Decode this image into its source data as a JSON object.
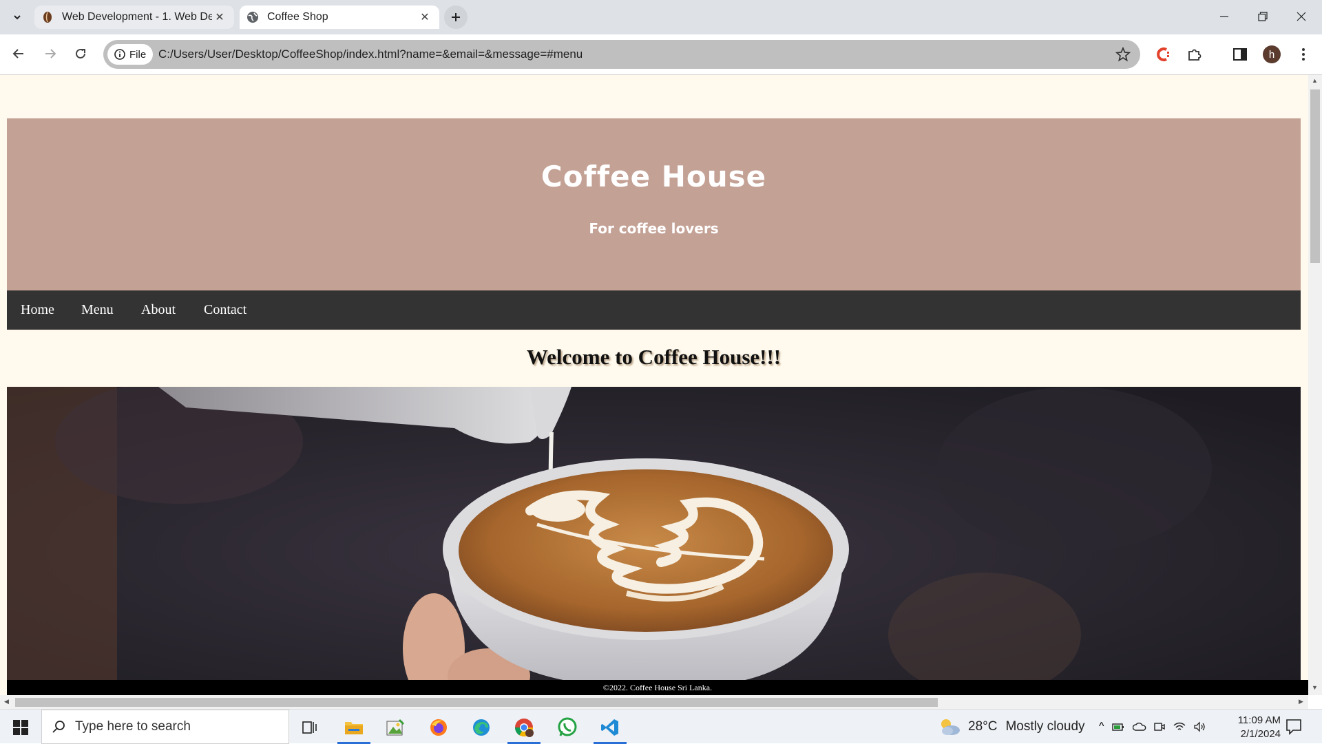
{
  "browser": {
    "tabs": [
      {
        "title": "Web Development - 1. Web De",
        "state": "inactive"
      },
      {
        "title": "Coffee Shop",
        "state": "active"
      }
    ],
    "address": {
      "chip_label": "File",
      "url": "C:/Users/User/Desktop/CoffeeShop/index.html?name=&email=&message=#menu"
    },
    "profile_initial": "h"
  },
  "page": {
    "site_title": "Coffee House",
    "tagline": "For coffee lovers",
    "nav": [
      "Home",
      "Menu",
      "About",
      "Contact"
    ],
    "welcome": "Welcome to Coffee House!!!",
    "footer": "©2022. Coffee House Sri Lanka.",
    "colors": {
      "background": "#fffaed",
      "header": "#c4a195",
      "nav": "#333333",
      "footer": "#000000"
    }
  },
  "taskbar": {
    "search_placeholder": "Type here to search",
    "weather_temp": "28°C",
    "weather_text": "Mostly cloudy",
    "time": "11:09 AM",
    "date": "2/1/2024"
  }
}
